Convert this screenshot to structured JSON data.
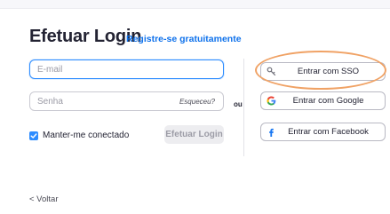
{
  "header": {
    "title": "Efetuar Login",
    "signup_link": "Registre-se gratuitamente"
  },
  "form": {
    "email_placeholder": "E-mail",
    "password_placeholder": "Senha",
    "forgot_label": "Esqueceu?",
    "keep_signed_in_label": "Manter-me conectado",
    "keep_signed_in_checked": true,
    "login_button": "Efetuar Login"
  },
  "separator": {
    "or_label": "ou"
  },
  "sso_options": {
    "sso": {
      "label": "Entrar com SSO",
      "icon": "key-icon"
    },
    "google": {
      "label": "Entrar com Google",
      "icon": "google-icon"
    },
    "facebook": {
      "label": "Entrar com Facebook",
      "icon": "facebook-icon"
    }
  },
  "footer": {
    "back_label": "< Voltar"
  },
  "colors": {
    "accent": "#2d8cff",
    "link": "#0e71eb",
    "highlight_annotation": "#f0a265"
  }
}
